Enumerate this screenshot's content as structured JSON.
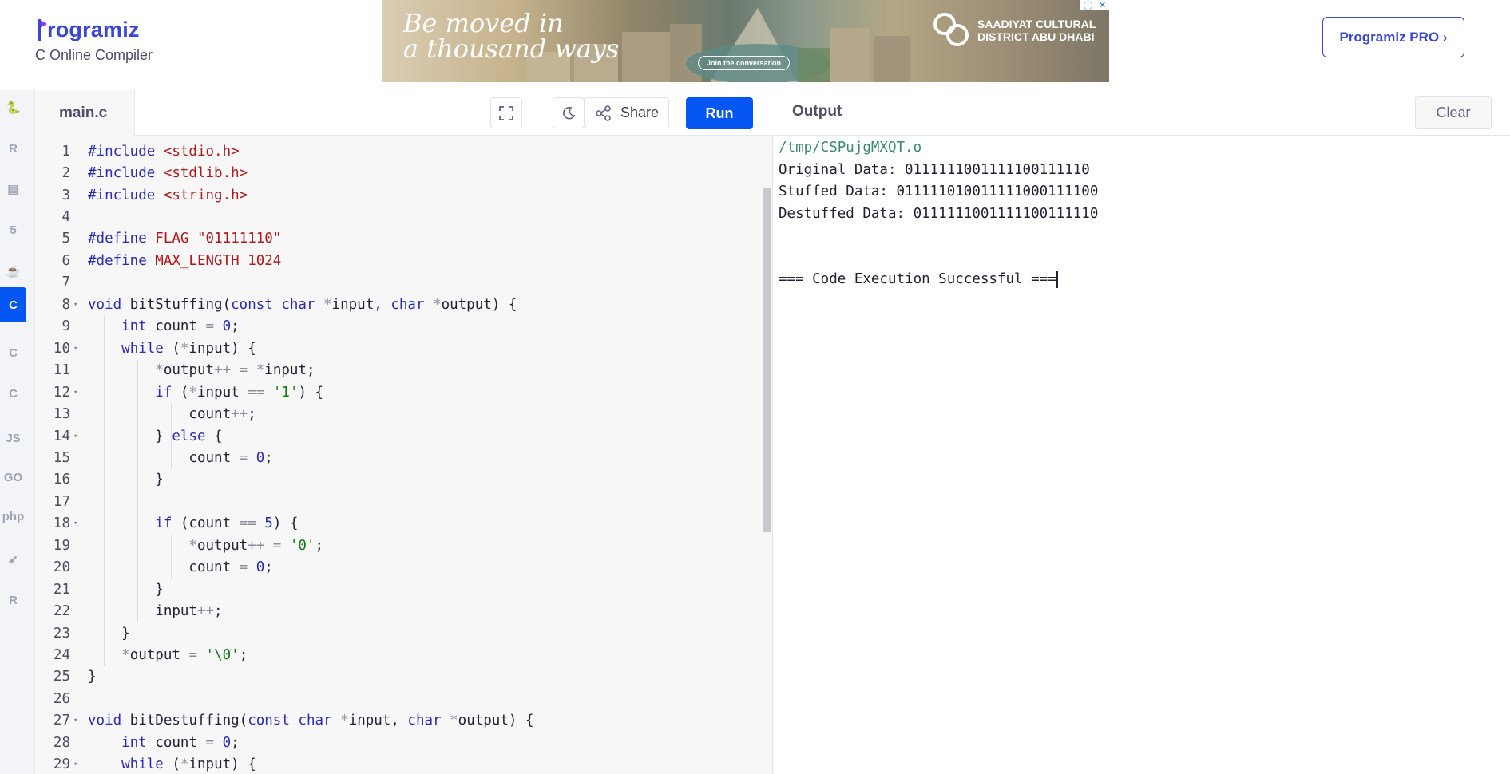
{
  "header": {
    "logo_text": "rogramiz",
    "subtitle": "C Online Compiler",
    "pro_button": "Programiz PRO ›"
  },
  "ad": {
    "line1": "Be moved in",
    "line2": "a thousand ways",
    "cta": "Join the conversation",
    "brand": "SAADIYAT CULTURAL DISTRICT ABU DHABI",
    "info_icon": "ⓘ",
    "close_icon": "✕"
  },
  "rail": {
    "items": [
      {
        "name": "python",
        "glyph": "🐍"
      },
      {
        "name": "r",
        "glyph": "R"
      },
      {
        "name": "sql",
        "glyph": "▤"
      },
      {
        "name": "html",
        "glyph": "5"
      },
      {
        "name": "java",
        "glyph": "☕"
      },
      {
        "name": "c",
        "glyph": "C"
      },
      {
        "name": "cpp",
        "glyph": "C"
      },
      {
        "name": "csharp",
        "glyph": "C"
      },
      {
        "name": "js",
        "glyph": "JS"
      },
      {
        "name": "go",
        "glyph": "GO"
      },
      {
        "name": "php",
        "glyph": "php"
      },
      {
        "name": "swift",
        "glyph": "➶"
      },
      {
        "name": "rust",
        "glyph": "R"
      }
    ]
  },
  "editor": {
    "file_tab": "main.c",
    "share_label": "Share",
    "run_label": "Run",
    "lines": [
      {
        "n": "1",
        "fold": "",
        "segs": [
          [
            "kw",
            "#include "
          ],
          [
            "str",
            "<stdio.h>"
          ]
        ]
      },
      {
        "n": "2",
        "fold": "",
        "segs": [
          [
            "kw",
            "#include "
          ],
          [
            "str",
            "<stdlib.h>"
          ]
        ]
      },
      {
        "n": "3",
        "fold": "",
        "segs": [
          [
            "kw",
            "#include "
          ],
          [
            "str",
            "<string.h>"
          ]
        ]
      },
      {
        "n": "4",
        "fold": "",
        "segs": []
      },
      {
        "n": "5",
        "fold": "",
        "segs": [
          [
            "kw",
            "#define "
          ],
          [
            "str",
            "FLAG \"01111110\""
          ]
        ]
      },
      {
        "n": "6",
        "fold": "",
        "segs": [
          [
            "kw",
            "#define "
          ],
          [
            "str",
            "MAX_LENGTH 1024"
          ]
        ]
      },
      {
        "n": "7",
        "fold": "",
        "segs": []
      },
      {
        "n": "8",
        "fold": "▾",
        "segs": [
          [
            "kw",
            "void "
          ],
          [
            "code",
            "bitStuffing("
          ],
          [
            "kw",
            "const char "
          ],
          [
            "op",
            "*"
          ],
          [
            "code",
            "input, "
          ],
          [
            "kw",
            "char "
          ],
          [
            "op",
            "*"
          ],
          [
            "code",
            "output) {"
          ]
        ]
      },
      {
        "n": "9",
        "fold": "",
        "segs": [
          [
            "code",
            "    "
          ],
          [
            "kw",
            "int "
          ],
          [
            "code",
            "count "
          ],
          [
            "op",
            "= "
          ],
          [
            "num",
            "0"
          ],
          [
            "code",
            ";"
          ]
        ]
      },
      {
        "n": "10",
        "fold": "▾",
        "segs": [
          [
            "code",
            "    "
          ],
          [
            "kw",
            "while "
          ],
          [
            "code",
            "("
          ],
          [
            "op",
            "*"
          ],
          [
            "code",
            "input) {"
          ]
        ]
      },
      {
        "n": "11",
        "fold": "",
        "segs": [
          [
            "code",
            "        "
          ],
          [
            "op",
            "*"
          ],
          [
            "code",
            "output"
          ],
          [
            "op",
            "++ = *"
          ],
          [
            "code",
            "input;"
          ]
        ]
      },
      {
        "n": "12",
        "fold": "▾",
        "segs": [
          [
            "code",
            "        "
          ],
          [
            "kw",
            "if "
          ],
          [
            "code",
            "("
          ],
          [
            "op",
            "*"
          ],
          [
            "code",
            "input "
          ],
          [
            "op",
            "== "
          ],
          [
            "chr",
            "'1'"
          ],
          [
            "code",
            ") {"
          ]
        ]
      },
      {
        "n": "13",
        "fold": "",
        "segs": [
          [
            "code",
            "            count"
          ],
          [
            "op",
            "++"
          ],
          [
            "code",
            ";"
          ]
        ]
      },
      {
        "n": "14",
        "fold": "▾",
        "segs": [
          [
            "code",
            "        } "
          ],
          [
            "kw",
            "else "
          ],
          [
            "code",
            "{"
          ]
        ]
      },
      {
        "n": "15",
        "fold": "",
        "segs": [
          [
            "code",
            "            count "
          ],
          [
            "op",
            "= "
          ],
          [
            "num",
            "0"
          ],
          [
            "code",
            ";"
          ]
        ]
      },
      {
        "n": "16",
        "fold": "",
        "segs": [
          [
            "code",
            "        }"
          ]
        ]
      },
      {
        "n": "17",
        "fold": "",
        "segs": []
      },
      {
        "n": "18",
        "fold": "▾",
        "segs": [
          [
            "code",
            "        "
          ],
          [
            "kw",
            "if "
          ],
          [
            "code",
            "(count "
          ],
          [
            "op",
            "== "
          ],
          [
            "num",
            "5"
          ],
          [
            "code",
            ") {"
          ]
        ]
      },
      {
        "n": "19",
        "fold": "",
        "segs": [
          [
            "code",
            "            "
          ],
          [
            "op",
            "*"
          ],
          [
            "code",
            "output"
          ],
          [
            "op",
            "++ = "
          ],
          [
            "chr",
            "'0'"
          ],
          [
            "code",
            ";"
          ]
        ]
      },
      {
        "n": "20",
        "fold": "",
        "segs": [
          [
            "code",
            "            count "
          ],
          [
            "op",
            "= "
          ],
          [
            "num",
            "0"
          ],
          [
            "code",
            ";"
          ]
        ]
      },
      {
        "n": "21",
        "fold": "",
        "segs": [
          [
            "code",
            "        }"
          ]
        ]
      },
      {
        "n": "22",
        "fold": "",
        "segs": [
          [
            "code",
            "        input"
          ],
          [
            "op",
            "++"
          ],
          [
            "code",
            ";"
          ]
        ]
      },
      {
        "n": "23",
        "fold": "",
        "segs": [
          [
            "code",
            "    }"
          ]
        ]
      },
      {
        "n": "24",
        "fold": "",
        "segs": [
          [
            "code",
            "    "
          ],
          [
            "op",
            "*"
          ],
          [
            "code",
            "output "
          ],
          [
            "op",
            "= "
          ],
          [
            "chr",
            "'\\0'"
          ],
          [
            "code",
            ";"
          ]
        ]
      },
      {
        "n": "25",
        "fold": "",
        "segs": [
          [
            "code",
            "}"
          ]
        ]
      },
      {
        "n": "26",
        "fold": "",
        "segs": []
      },
      {
        "n": "27",
        "fold": "▾",
        "segs": [
          [
            "kw",
            "void "
          ],
          [
            "code",
            "bitDestuffing("
          ],
          [
            "kw",
            "const char "
          ],
          [
            "op",
            "*"
          ],
          [
            "code",
            "input, "
          ],
          [
            "kw",
            "char "
          ],
          [
            "op",
            "*"
          ],
          [
            "code",
            "output) {"
          ]
        ]
      },
      {
        "n": "28",
        "fold": "",
        "segs": [
          [
            "code",
            "    "
          ],
          [
            "kw",
            "int "
          ],
          [
            "code",
            "count "
          ],
          [
            "op",
            "= "
          ],
          [
            "num",
            "0"
          ],
          [
            "code",
            ";"
          ]
        ]
      },
      {
        "n": "29",
        "fold": "▾",
        "segs": [
          [
            "code",
            "    "
          ],
          [
            "kw",
            "while "
          ],
          [
            "code",
            "("
          ],
          [
            "op",
            "*"
          ],
          [
            "code",
            "input) {"
          ]
        ]
      }
    ]
  },
  "output": {
    "title": "Output",
    "clear_label": "Clear",
    "lines": [
      {
        "cls": "out-path",
        "text": "/tmp/CSPujgMXQT.o"
      },
      {
        "cls": "",
        "text": "Original Data: 0111111001111100111110"
      },
      {
        "cls": "",
        "text": "Stuffed Data: 011111010011111000111100"
      },
      {
        "cls": "",
        "text": "Destuffed Data: 0111111001111100111110"
      },
      {
        "cls": "",
        "text": ""
      },
      {
        "cls": "",
        "text": ""
      },
      {
        "cls": "",
        "text": "=== Code Execution Successful ==="
      }
    ]
  },
  "colors": {
    "brand": "#3a47d1",
    "accent": "#0556f3"
  }
}
